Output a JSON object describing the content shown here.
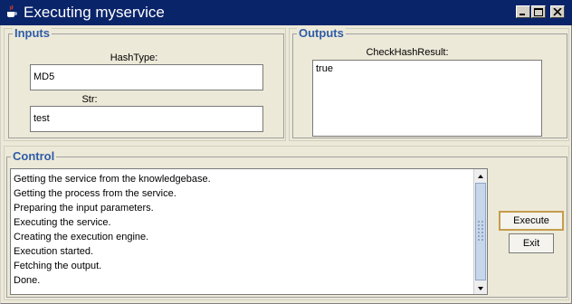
{
  "window": {
    "title": "Executing myservice",
    "icon": "java-coffee-icon"
  },
  "inputs": {
    "legend": "Inputs",
    "hash_type_label": "HashType:",
    "hash_type_value": "MD5",
    "str_label": "Str:",
    "str_value": "test"
  },
  "outputs": {
    "legend": "Outputs",
    "result_label": "CheckHashResult:",
    "result_value": "true"
  },
  "control": {
    "legend": "Control",
    "log_lines": [
      "Getting the service from the knowledgebase.",
      "Getting the process from the service.",
      "Preparing the input parameters.",
      "Executing the service.",
      "Creating the execution engine.",
      "Execution started.",
      "Fetching the output.",
      "Done."
    ],
    "execute_label": "Execute",
    "exit_label": "Exit"
  },
  "colors": {
    "titlebar": "#0a246a",
    "legend_text": "#2f5ca8",
    "window_bg": "#ece9d8",
    "focus_border": "#c69c4c"
  }
}
